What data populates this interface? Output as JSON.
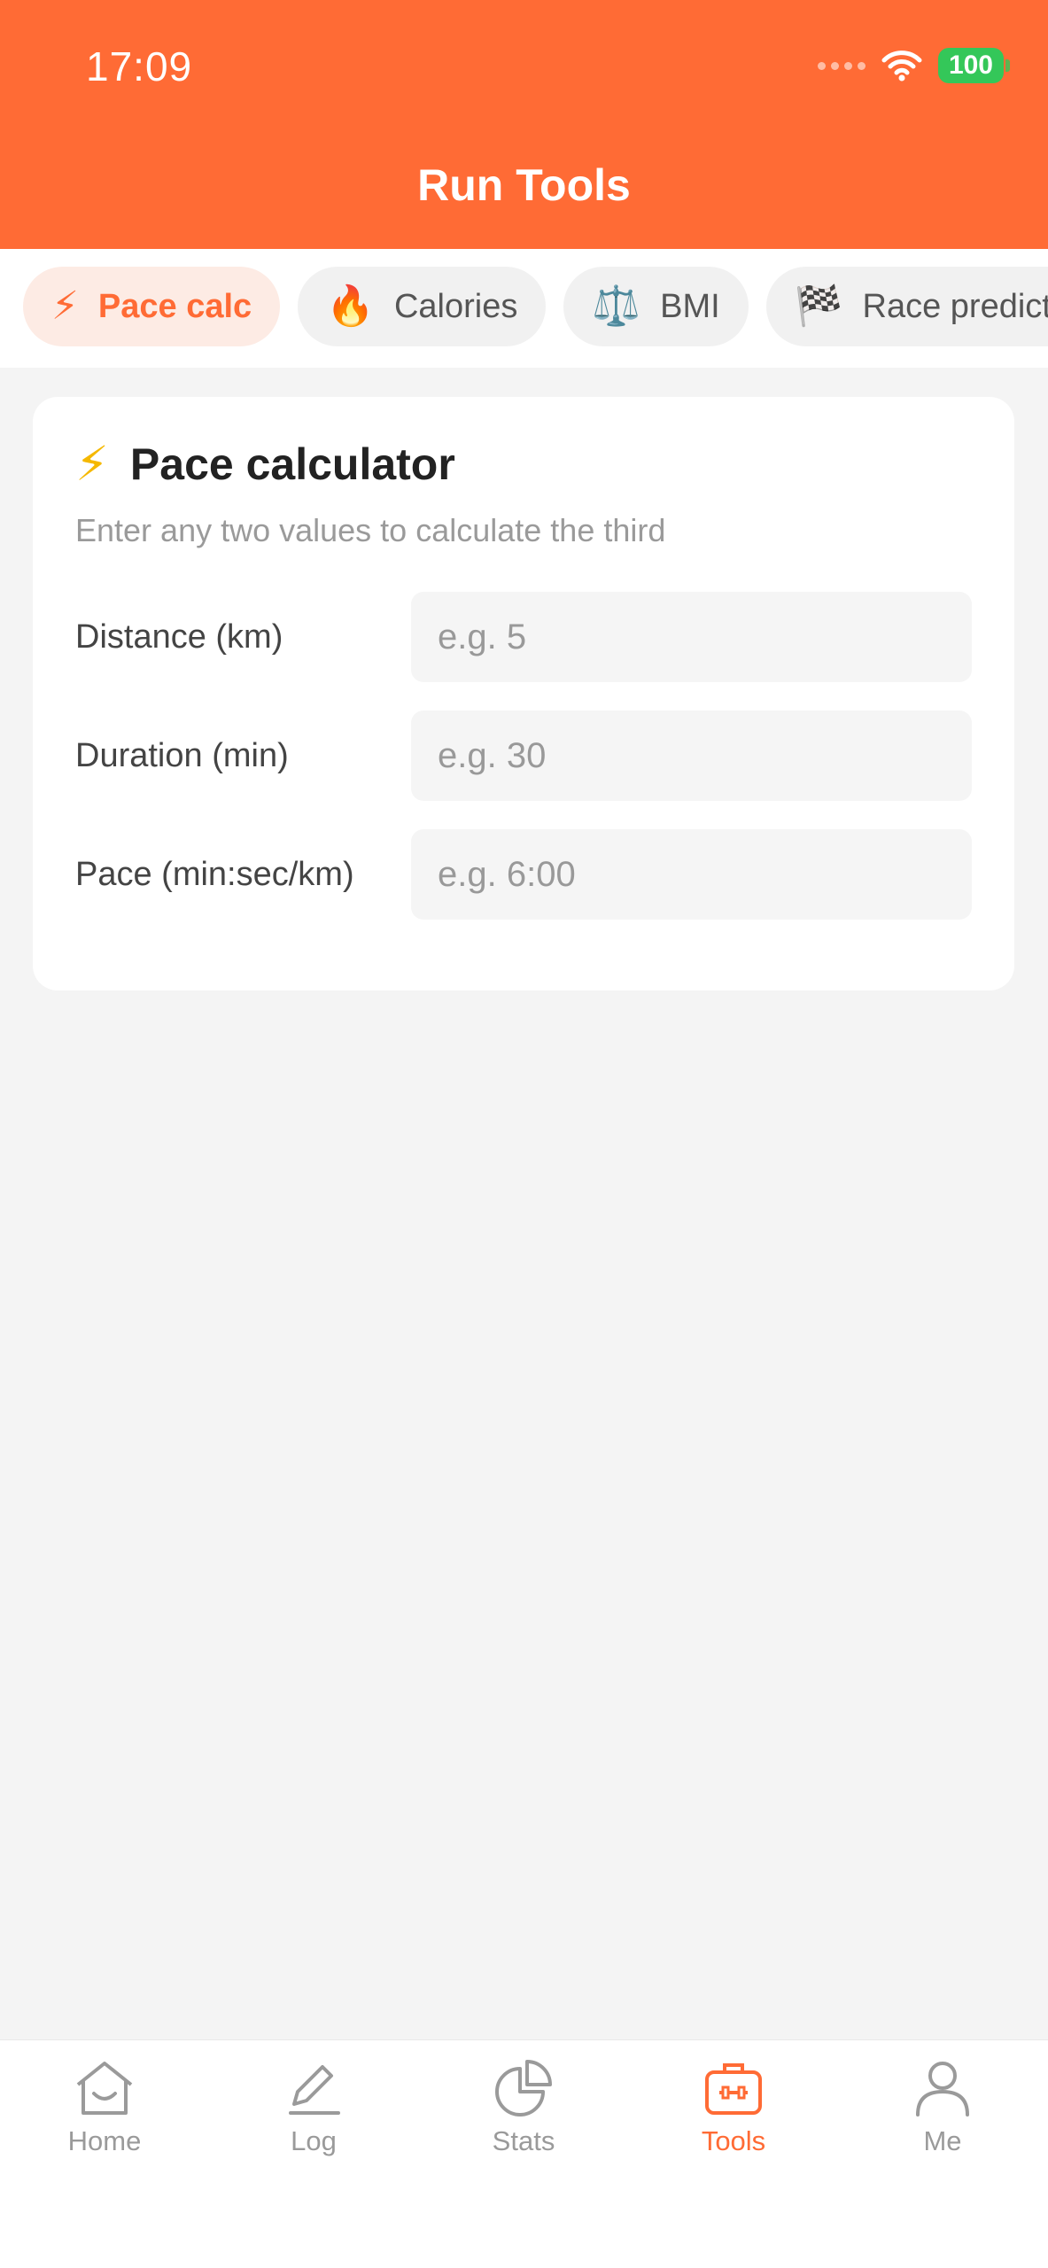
{
  "status_bar": {
    "time": "17:09",
    "battery": "100"
  },
  "header": {
    "title": "Run Tools"
  },
  "tabs": [
    {
      "icon": "⚡",
      "label": "Pace calc",
      "active": true
    },
    {
      "icon": "🔥",
      "label": "Calories",
      "active": false
    },
    {
      "icon": "⚖️",
      "label": "BMI",
      "active": false
    },
    {
      "icon": "🏁",
      "label": "Race predictor",
      "active": false
    }
  ],
  "card": {
    "icon": "⚡",
    "title": "Pace calculator",
    "subtitle": "Enter any two values to calculate the third",
    "fields": [
      {
        "label": "Distance (km)",
        "placeholder": "e.g. 5",
        "value": ""
      },
      {
        "label": "Duration (min)",
        "placeholder": "e.g. 30",
        "value": ""
      },
      {
        "label": "Pace (min:sec/km)",
        "placeholder": "e.g. 6:00",
        "value": ""
      }
    ]
  },
  "bottom_nav": [
    {
      "label": "Home",
      "icon": "home-icon",
      "active": false
    },
    {
      "label": "Log",
      "icon": "pencil-icon",
      "active": false
    },
    {
      "label": "Stats",
      "icon": "pie-chart-icon",
      "active": false
    },
    {
      "label": "Tools",
      "icon": "toolbox-icon",
      "active": true
    },
    {
      "label": "Me",
      "icon": "person-icon",
      "active": false
    }
  ],
  "colors": {
    "accent": "#ff6b35",
    "background": "#f4f4f4",
    "battery": "#34c759"
  }
}
